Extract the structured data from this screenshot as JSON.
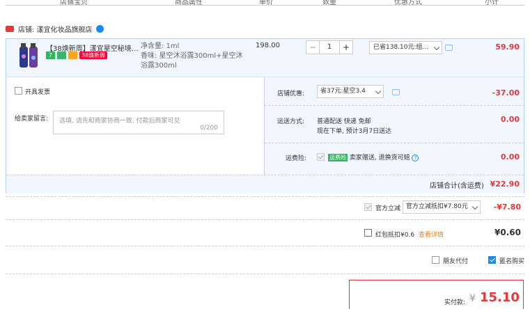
{
  "header": {
    "cols": [
      "店铺宝贝",
      "商品属性",
      "单价",
      "数量",
      "优惠方式",
      "小计"
    ]
  },
  "store": {
    "name": "店铺: 漾宜化妆品旗舰店"
  },
  "item": {
    "title": "【38焕新周】漾宜星空秘境沐...",
    "tag_38": "38焕新周",
    "tag_7": "7",
    "sku_line1": "净含量: 1ml",
    "sku_line2": "香味: 星空沐浴露300ml+星空沐浴露300ml",
    "price": "198.00",
    "qty": "1",
    "qty_minus": "−",
    "qty_plus": "+",
    "promo": "已省138.10元:组...",
    "subtotal": "59.90"
  },
  "order": {
    "invoice_label": "开具发票",
    "message_label": "给卖家留言:",
    "message_placeholder": "选填, 请先和商家协商一致, 付款后商家可见",
    "message_count": "0/200",
    "store_promo_label": "店铺优惠:",
    "store_promo_value": "省37元:星空3.4",
    "store_promo_amount": "-37.00",
    "shipping_label": "运送方式:",
    "shipping_line1": "普通配送 快递 免邮",
    "shipping_line2": "现在下单, 预计3月7日送达",
    "shipping_amount": "0.00",
    "insurance_label": "运费险:",
    "insurance_badge": "运费险",
    "insurance_text": "卖家赠送, 退换货可赔",
    "insurance_amount": "0.00",
    "store_total_label": "店铺合计(含运费)",
    "store_total": "¥22.90"
  },
  "summary": {
    "official_label": "官方立减",
    "official_value": "官方立减抵扣¥7.80元",
    "official_amount": "-¥7.80",
    "redpacket_label": "红包抵扣¥0.6",
    "redpacket_link": "查看详情",
    "redpacket_amount": "¥0.60",
    "friend_pay": "朋友代付",
    "anonymous": "匿名购买",
    "pay_label": "实付款:",
    "pay_currency": "¥",
    "pay_amount": "15.10"
  },
  "colors": {
    "accent": "#e4393c",
    "blue": "#1e8af0",
    "panel": "#f2f7ff"
  }
}
